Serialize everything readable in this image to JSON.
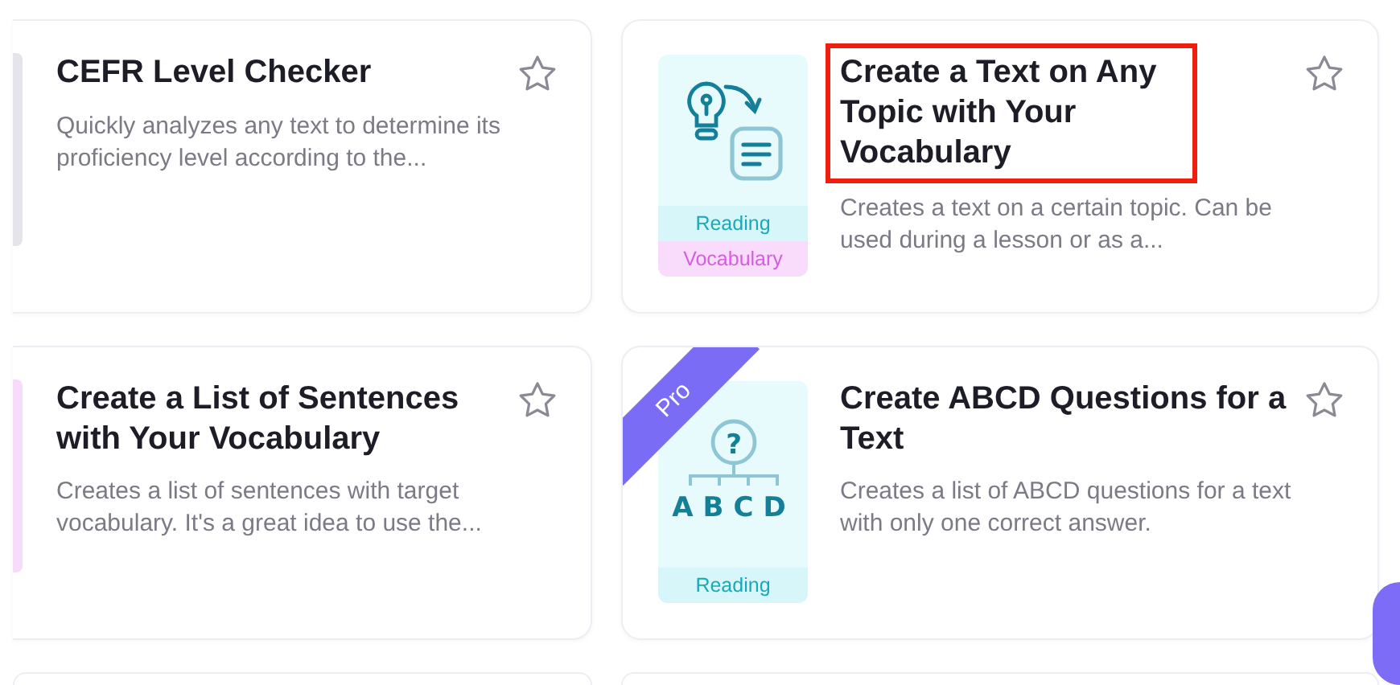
{
  "cards": [
    {
      "title": "CEFR Level Checker",
      "description": "Quickly analyzes any text to determine its proficiency level according to the...",
      "favorite": false,
      "kind": "strip",
      "color": "#e4e4ea"
    },
    {
      "title": "Create a Text on Any Topic with Your Vocabulary",
      "description": "Creates a text on a certain topic. Can be used during a lesson or as a...",
      "favorite": false,
      "highlighted": true,
      "kind": "idea",
      "tags": [
        {
          "label": "Reading",
          "kind": "reading"
        },
        {
          "label": "Vocabulary",
          "kind": "vocabulary"
        }
      ]
    },
    {
      "title": "Create a List of Sentences with Your Vocabulary",
      "description": "Creates a list of sentences with target vocabulary. It's a great idea to use the...",
      "favorite": false,
      "kind": "strip",
      "color": "#f6dcf8"
    },
    {
      "title": "Create ABCD Questions for a Text",
      "description": "Creates a list of ABCD questions for a text with only one correct answer.",
      "favorite": false,
      "pro": true,
      "pro_label": "Pro",
      "kind": "abcd",
      "icon_mark": "?",
      "icon_text": "ABCD",
      "tags": [
        {
          "label": "Reading",
          "kind": "reading"
        }
      ]
    }
  ]
}
